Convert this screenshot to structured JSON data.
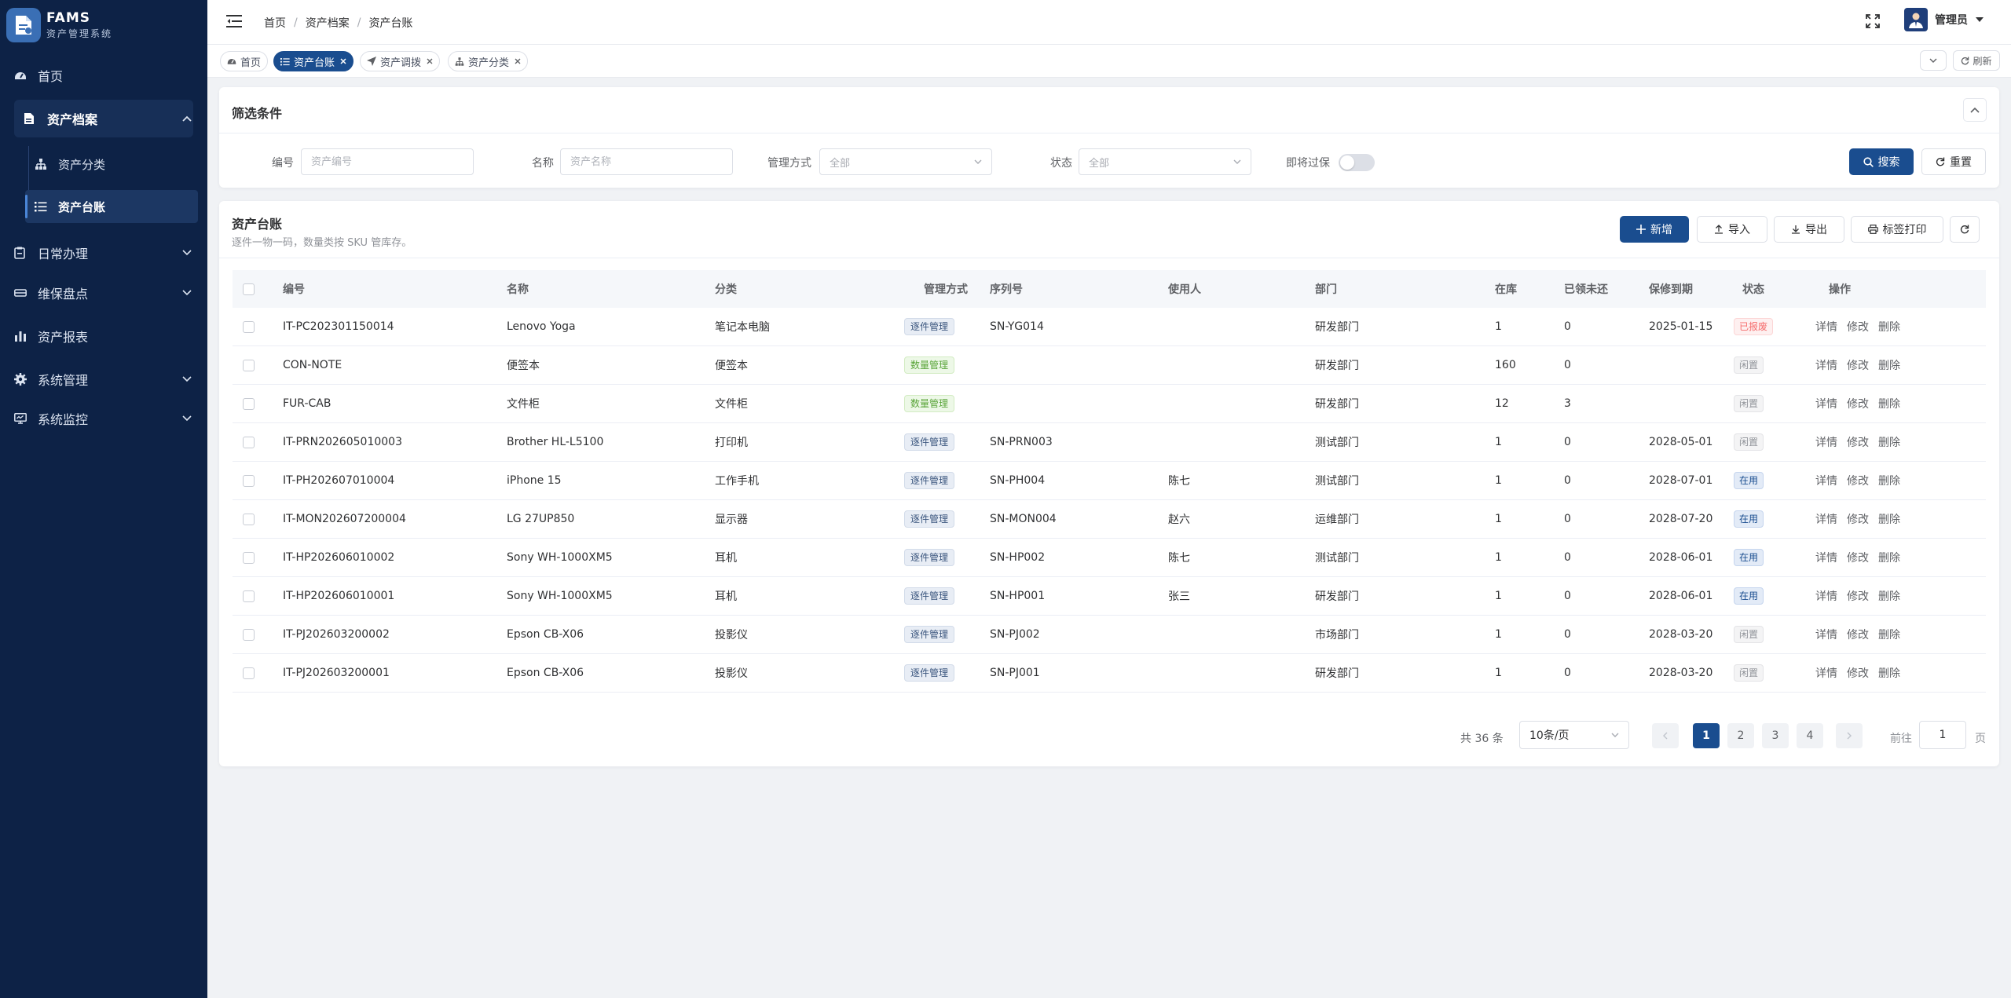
{
  "app": {
    "title": "FAMS",
    "subtitle": "资产管理系统"
  },
  "sidebar": {
    "items": [
      {
        "label": "首页",
        "icon": "dashboard-icon"
      },
      {
        "label": "资产档案",
        "icon": "file-icon",
        "expanded": true,
        "children": [
          {
            "label": "资产分类",
            "icon": "tree-icon"
          },
          {
            "label": "资产台账",
            "icon": "list-icon",
            "active": true
          }
        ]
      },
      {
        "label": "日常办理",
        "icon": "clipboard-icon"
      },
      {
        "label": "维保盘点",
        "icon": "wrench-icon"
      },
      {
        "label": "资产报表",
        "icon": "bar-chart-icon"
      },
      {
        "label": "系统管理",
        "icon": "gear-icon"
      },
      {
        "label": "系统监控",
        "icon": "monitor-icon"
      }
    ]
  },
  "header": {
    "breadcrumb": [
      "首页",
      "资产档案",
      "资产台账"
    ],
    "user": "管理员"
  },
  "tabs": [
    {
      "label": "首页",
      "icon": "dashboard-icon",
      "closable": false
    },
    {
      "label": "资产台账",
      "icon": "list-icon",
      "closable": true,
      "active": true
    },
    {
      "label": "资产调拨",
      "icon": "send-icon",
      "closable": true
    },
    {
      "label": "资产分类",
      "icon": "tree-icon",
      "closable": true
    }
  ],
  "tabs_refresh": "刷新",
  "filter": {
    "title": "筛选条件",
    "code_label": "编号",
    "code_placeholder": "资产编号",
    "name_label": "名称",
    "name_placeholder": "资产名称",
    "mode_label": "管理方式",
    "mode_value": "全部",
    "status_label": "状态",
    "status_value": "全部",
    "expiring_label": "即将过保",
    "search_button": "搜索",
    "reset_button": "重置"
  },
  "ledger": {
    "title": "资产台账",
    "subtitle": "逐件一物一码，数量类按 SKU 管库存。",
    "add_button": "新增",
    "import_button": "导入",
    "export_button": "导出",
    "print_button": "标签打印"
  },
  "table": {
    "columns": [
      "编号",
      "名称",
      "分类",
      "管理方式",
      "序列号",
      "使用人",
      "部门",
      "在库",
      "已领未还",
      "保修到期",
      "状态",
      "操作"
    ],
    "actions": [
      "详情",
      "修改",
      "删除"
    ],
    "rows": [
      {
        "code": "IT-PC202301150014",
        "name": "Lenovo Yoga",
        "category": "笔记本电脑",
        "mode": "逐件管理",
        "mode_type": "item",
        "serial": "SN-YG014",
        "user": "",
        "dept": "研发部门",
        "stock": "1",
        "borrowed": "0",
        "warranty": "2025-01-15",
        "status": "已报废",
        "status_type": "scrap"
      },
      {
        "code": "CON-NOTE",
        "name": "便签本",
        "category": "便签本",
        "mode": "数量管理",
        "mode_type": "qty",
        "serial": "",
        "user": "",
        "dept": "研发部门",
        "stock": "160",
        "borrowed": "0",
        "warranty": "",
        "status": "闲置",
        "status_type": "idle"
      },
      {
        "code": "FUR-CAB",
        "name": "文件柜",
        "category": "文件柜",
        "mode": "数量管理",
        "mode_type": "qty",
        "serial": "",
        "user": "",
        "dept": "研发部门",
        "stock": "12",
        "borrowed": "3",
        "warranty": "",
        "status": "闲置",
        "status_type": "idle"
      },
      {
        "code": "IT-PRN202605010003",
        "name": "Brother HL-L5100",
        "category": "打印机",
        "mode": "逐件管理",
        "mode_type": "item",
        "serial": "SN-PRN003",
        "user": "",
        "dept": "测试部门",
        "stock": "1",
        "borrowed": "0",
        "warranty": "2028-05-01",
        "status": "闲置",
        "status_type": "idle"
      },
      {
        "code": "IT-PH202607010004",
        "name": "iPhone 15",
        "category": "工作手机",
        "mode": "逐件管理",
        "mode_type": "item",
        "serial": "SN-PH004",
        "user": "陈七",
        "dept": "测试部门",
        "stock": "1",
        "borrowed": "0",
        "warranty": "2028-07-01",
        "status": "在用",
        "status_type": "use"
      },
      {
        "code": "IT-MON202607200004",
        "name": "LG 27UP850",
        "category": "显示器",
        "mode": "逐件管理",
        "mode_type": "item",
        "serial": "SN-MON004",
        "user": "赵六",
        "dept": "运维部门",
        "stock": "1",
        "borrowed": "0",
        "warranty": "2028-07-20",
        "status": "在用",
        "status_type": "use"
      },
      {
        "code": "IT-HP202606010002",
        "name": "Sony WH-1000XM5",
        "category": "耳机",
        "mode": "逐件管理",
        "mode_type": "item",
        "serial": "SN-HP002",
        "user": "陈七",
        "dept": "测试部门",
        "stock": "1",
        "borrowed": "0",
        "warranty": "2028-06-01",
        "status": "在用",
        "status_type": "use"
      },
      {
        "code": "IT-HP202606010001",
        "name": "Sony WH-1000XM5",
        "category": "耳机",
        "mode": "逐件管理",
        "mode_type": "item",
        "serial": "SN-HP001",
        "user": "张三",
        "dept": "研发部门",
        "stock": "1",
        "borrowed": "0",
        "warranty": "2028-06-01",
        "status": "在用",
        "status_type": "use"
      },
      {
        "code": "IT-PJ202603200002",
        "name": "Epson CB-X06",
        "category": "投影仪",
        "mode": "逐件管理",
        "mode_type": "item",
        "serial": "SN-PJ002",
        "user": "",
        "dept": "市场部门",
        "stock": "1",
        "borrowed": "0",
        "warranty": "2028-03-20",
        "status": "闲置",
        "status_type": "idle"
      },
      {
        "code": "IT-PJ202603200001",
        "name": "Epson CB-X06",
        "category": "投影仪",
        "mode": "逐件管理",
        "mode_type": "item",
        "serial": "SN-PJ001",
        "user": "",
        "dept": "研发部门",
        "stock": "1",
        "borrowed": "0",
        "warranty": "2028-03-20",
        "status": "闲置",
        "status_type": "idle"
      }
    ]
  },
  "pagination": {
    "total": "共 36 条",
    "page_size": "10条/页",
    "pages": [
      "1",
      "2",
      "3",
      "4"
    ],
    "current": "1",
    "goto_label": "前往",
    "goto_value": "1",
    "goto_unit": "页"
  },
  "colors": {
    "sidebar_bg": "#0d2246",
    "primary": "#1a4d8f",
    "page_bg": "#f0f2f5"
  }
}
